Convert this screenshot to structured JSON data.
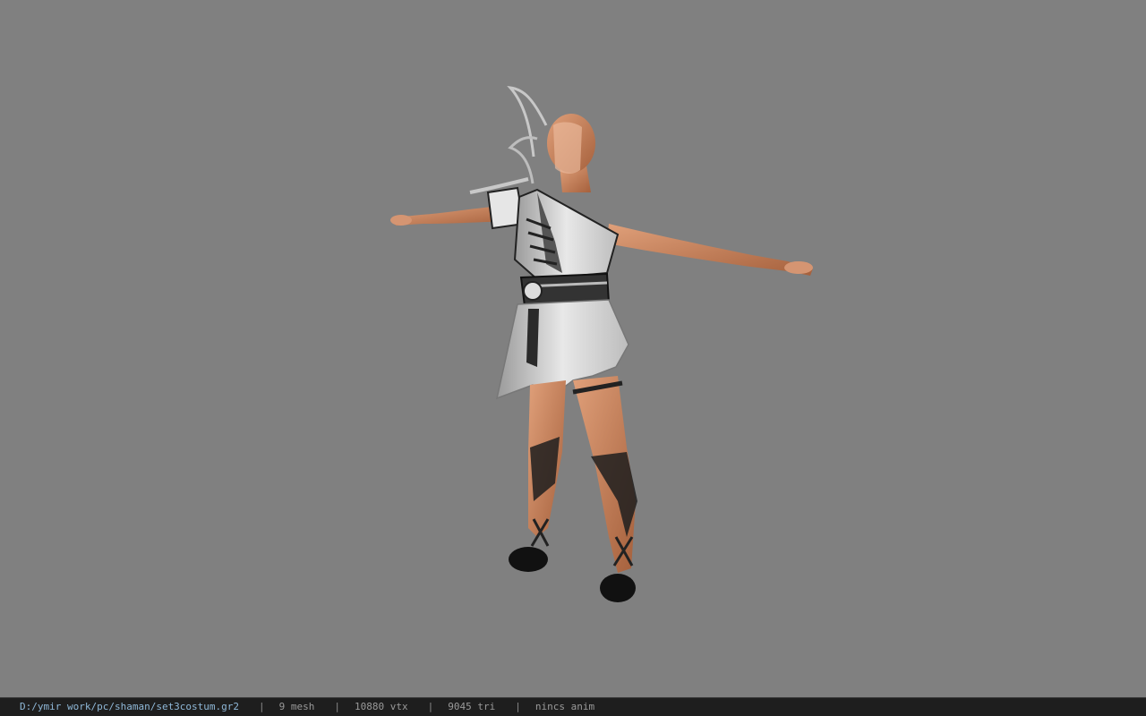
{
  "viewport": {
    "background": "#808080",
    "model_description_icon": "character-model"
  },
  "status_bar": {
    "file_path": "D:/ymir work/pc/shaman/set3costum.gr2",
    "separator": "|",
    "mesh": "9 mesh",
    "vertices": "10880 vtx",
    "triangles": "9045 tri",
    "animation": "nincs anim"
  },
  "colors": {
    "status_bg": "#1e1e1e",
    "path_text": "#8fb8d8",
    "status_text": "#9a9a9a"
  }
}
